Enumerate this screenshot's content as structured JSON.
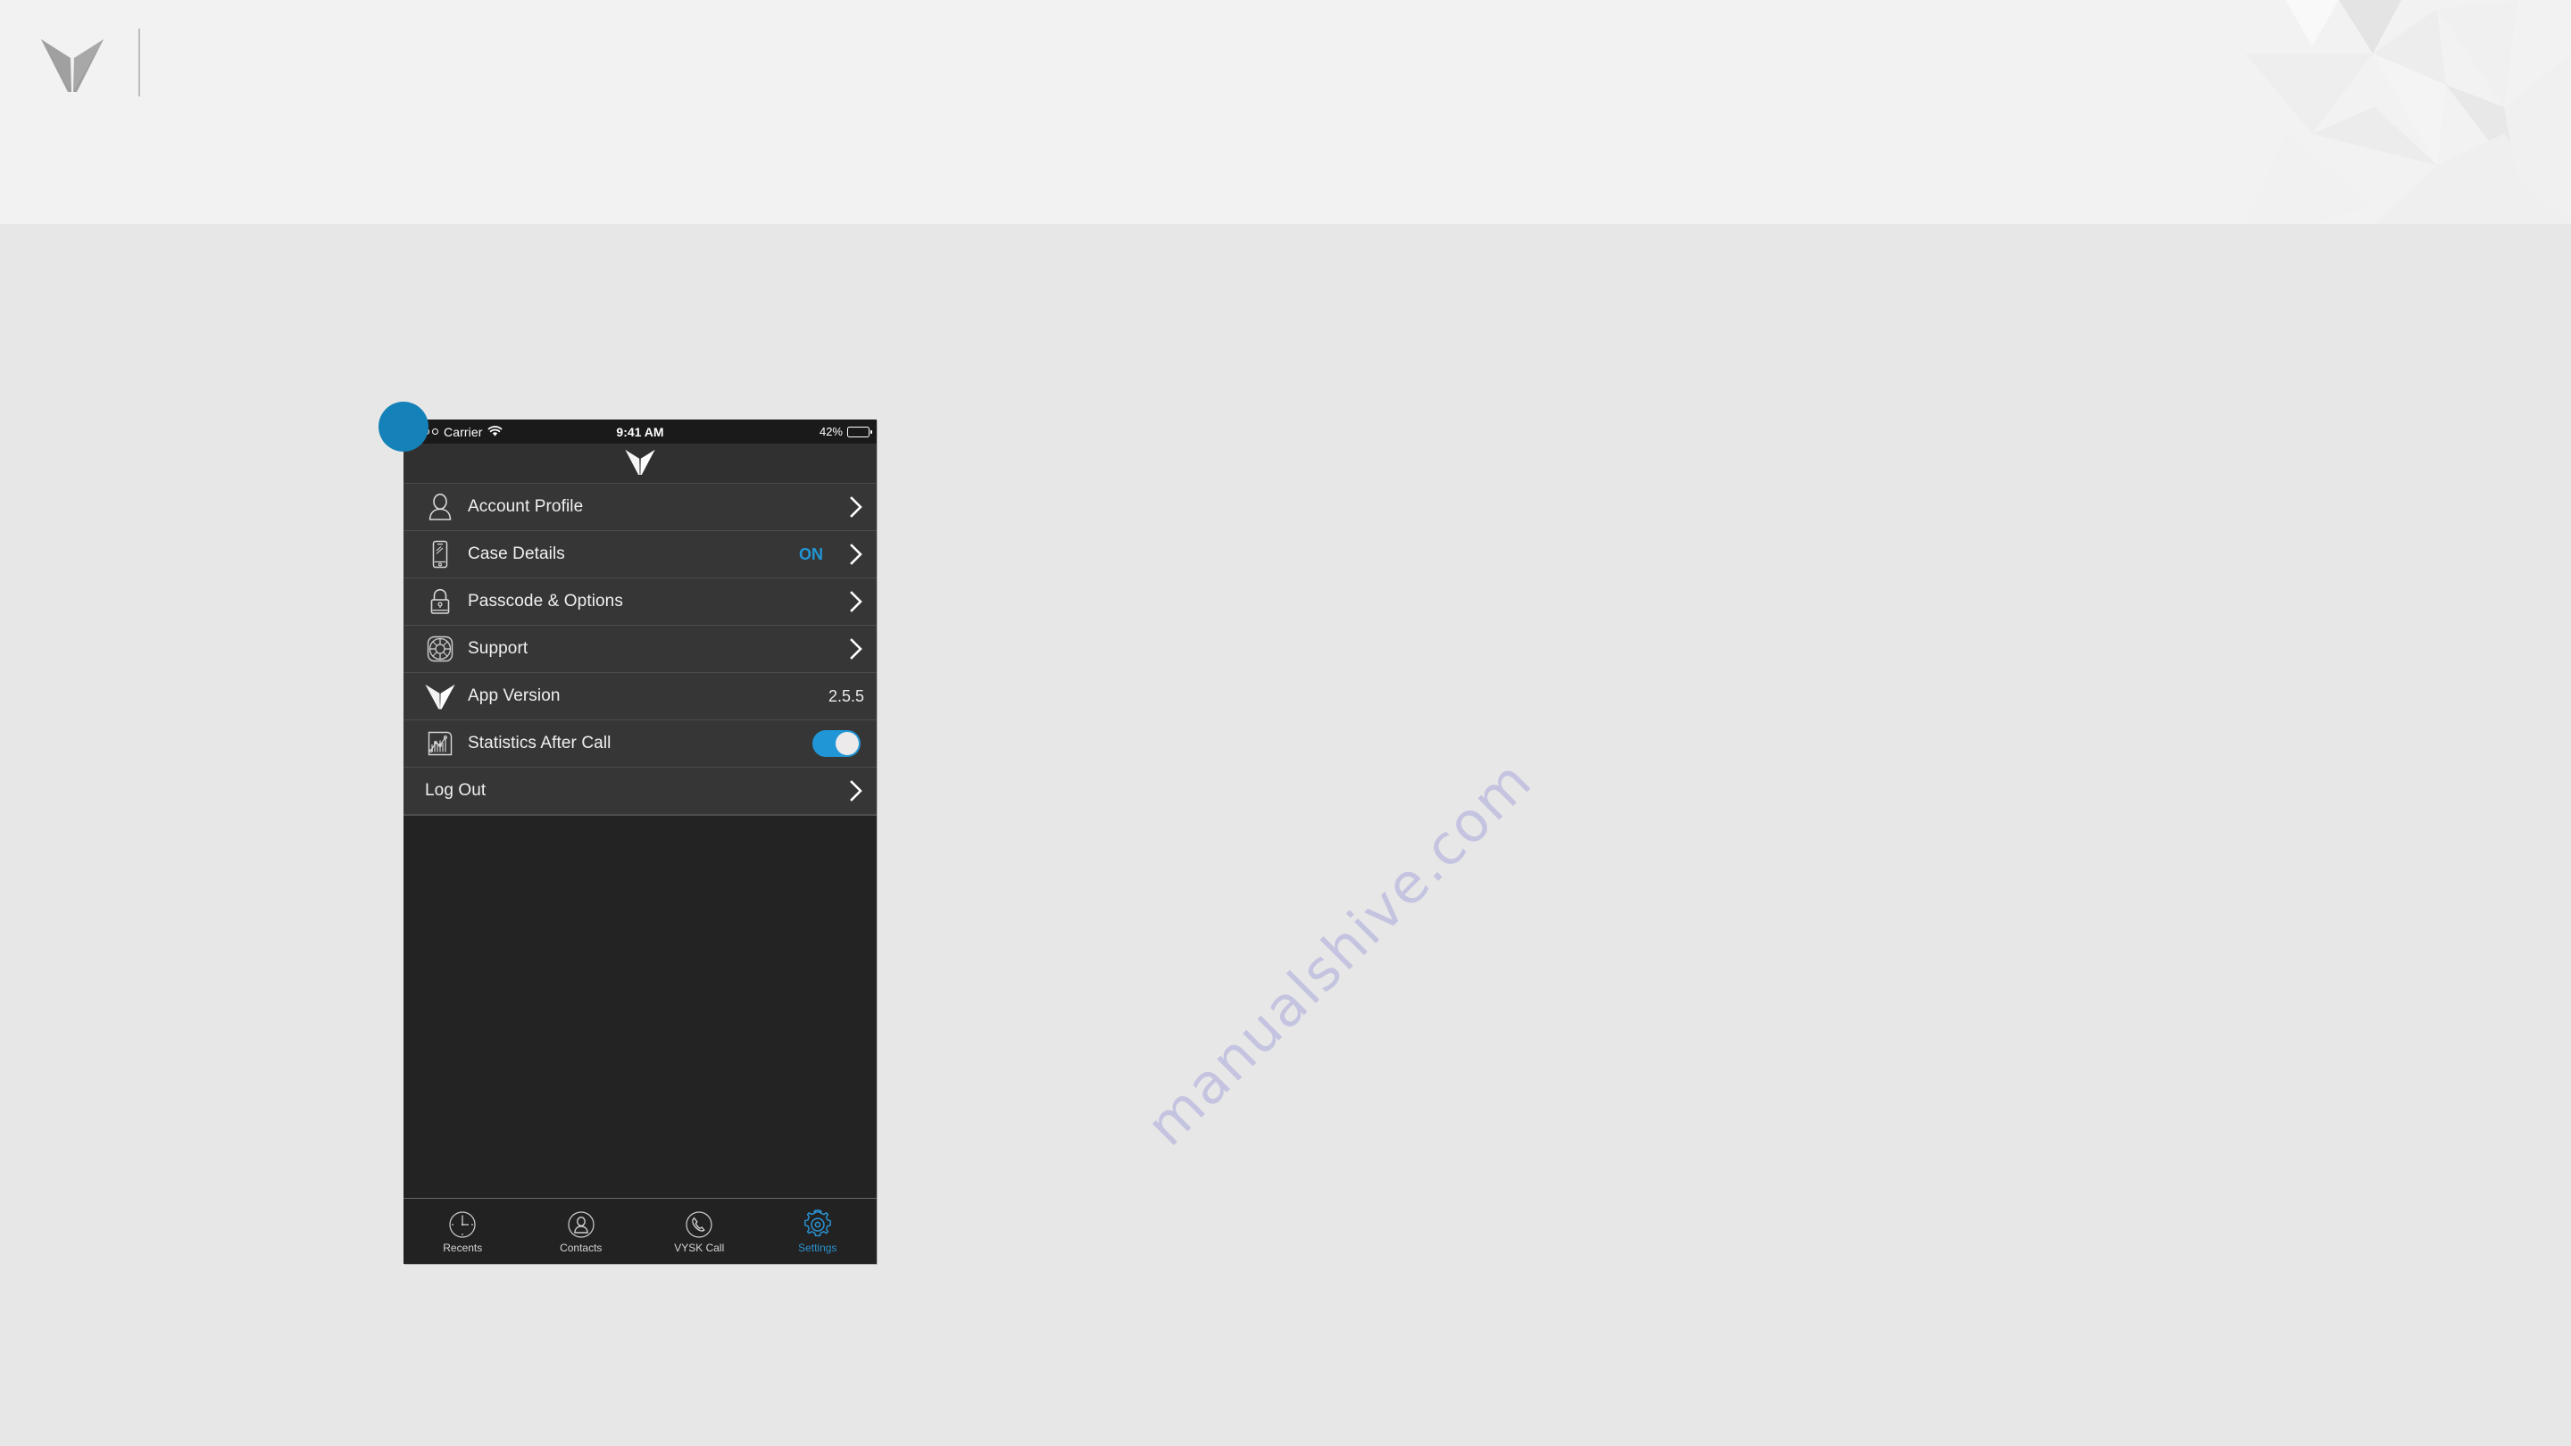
{
  "page": {
    "background_color": "#e7e7e7",
    "header_background_color": "#f2f2f2",
    "brand_logo": "vysk-chevron-logo",
    "watermark_text": "manualshive.com",
    "watermark_color": "#b9b9e0"
  },
  "callout": {
    "name": "callout-dot",
    "color": "#1481b8"
  },
  "phone": {
    "accent_color": "#2196d6",
    "status_bar": {
      "signal_dots": [
        true,
        false,
        false
      ],
      "carrier": "Carrier",
      "wifi_icon": "wifi-icon",
      "time": "9:41 AM",
      "battery_percent": "42%",
      "battery_icon": "battery-icon"
    },
    "nav_bar": {
      "logo_icon": "vysk-chevron-logo"
    },
    "rows": [
      {
        "icon": "person-outline-icon",
        "label": "Account Profile",
        "value": "",
        "value_style": "none",
        "accessory": "chevron"
      },
      {
        "icon": "phone-case-icon",
        "label": "Case Details",
        "value": "ON",
        "value_style": "accent",
        "accessory": "chevron"
      },
      {
        "icon": "padlock-icon",
        "label": "Passcode & Options",
        "value": "",
        "value_style": "none",
        "accessory": "chevron"
      },
      {
        "icon": "life-ring-support-icon",
        "label": "Support",
        "value": "",
        "value_style": "none",
        "accessory": "chevron"
      },
      {
        "icon": "vysk-chevron-logo",
        "label": "App Version",
        "value": "2.5.5",
        "value_style": "plain",
        "accessory": "none"
      },
      {
        "icon": "bar-chart-icon",
        "label": "Statistics After Call",
        "value": "",
        "value_style": "none",
        "accessory": "toggle",
        "toggle_on": true
      },
      {
        "icon": "none",
        "label": "Log Out",
        "value": "",
        "value_style": "none",
        "accessory": "chevron"
      }
    ],
    "tabs": [
      {
        "icon": "clock-icon",
        "label": "Recents",
        "active": false
      },
      {
        "icon": "contacts-person-icon",
        "label": "Contacts",
        "active": false
      },
      {
        "icon": "phone-handset-icon",
        "label": "VYSK Call",
        "active": false
      },
      {
        "icon": "gear-icon",
        "label": "Settings",
        "active": true
      }
    ]
  }
}
